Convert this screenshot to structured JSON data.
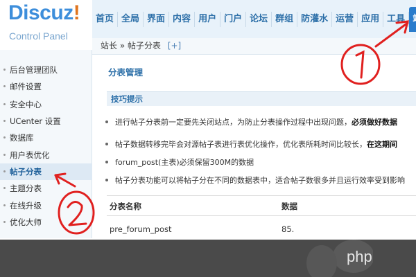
{
  "logo": {
    "brand_text": "Discuz",
    "brand_mark": "!",
    "subtitle": "Control Panel"
  },
  "topnav": {
    "items": [
      "首页",
      "全局",
      "界面",
      "内容",
      "用户",
      "门户",
      "论坛",
      "群组",
      "防灌水",
      "运营",
      "应用",
      "工具",
      "站"
    ]
  },
  "breadcrumb": {
    "text": "站长 » 帖子分表",
    "add": "[+]"
  },
  "sidebar": {
    "items": [
      "后台管理团队",
      "邮件设置",
      "安全中心",
      "UCenter 设置",
      "数据库",
      "用户表优化",
      "帖子分表",
      "主题分表",
      "在线升级",
      "优化大师"
    ],
    "active_index": 6
  },
  "main": {
    "title": "分表管理",
    "tips_header": "技巧提示",
    "tips": [
      {
        "text": "进行帖子分表前一定要先关闭站点，为防止分表操作过程中出现问题，",
        "bold": "必须做好数据"
      },
      {
        "text": "帖子数据转移完毕会对源帖子表进行表优化操作，优化表所耗时间比较长，",
        "bold": "在这期间"
      },
      {
        "text": "forum_post(主表)必须保留300M的数据",
        "bold": ""
      },
      {
        "text": "帖子分表功能可以将帖子分在不同的数据表中，适合帖子数很多并且运行效率受到影响",
        "bold": ""
      }
    ],
    "table": {
      "headers": [
        "分表名称",
        "数据"
      ],
      "rows": [
        [
          "pre_forum_post",
          "85."
        ]
      ]
    }
  },
  "annotations": {
    "one": "1",
    "two": "2"
  },
  "watermark": {
    "text": "php"
  }
}
